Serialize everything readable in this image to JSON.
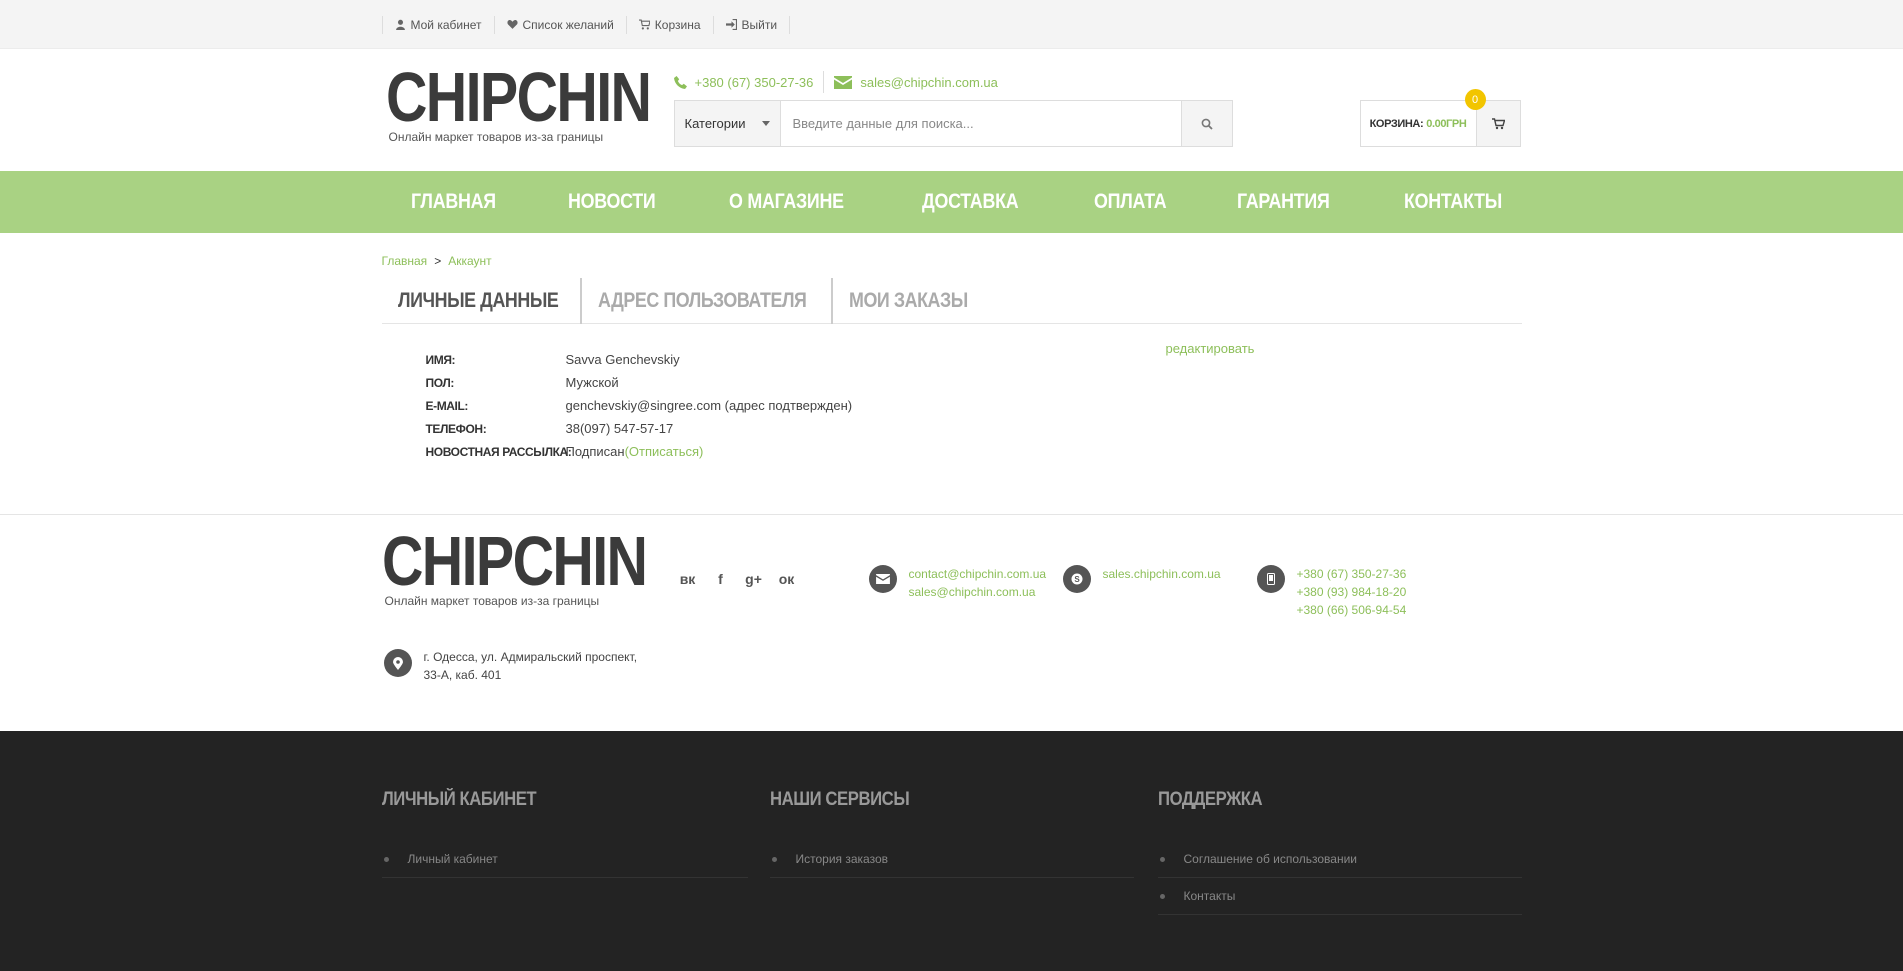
{
  "topbar": {
    "links": [
      {
        "label": "Мой кабинет",
        "icon": "user-icon"
      },
      {
        "label": "Список желаний",
        "icon": "heart-icon"
      },
      {
        "label": "Корзина",
        "icon": "cart-icon"
      },
      {
        "label": "Выйти",
        "icon": "sign-out-icon"
      }
    ]
  },
  "header": {
    "logo": "CHIPCHIN",
    "logo_sub": "Онлайн маркет товаров из-за границы",
    "phone": "+380 (67) 350-27-36",
    "email": "sales@chipchin.com.ua",
    "search": {
      "category": "Категории",
      "placeholder": "Введите данные для поиска..."
    },
    "cart": {
      "label": "КОРЗИНА:",
      "amount": "0.00ГРН",
      "count": "0"
    }
  },
  "nav": [
    "ГЛАВНАЯ",
    "НОВОСТИ",
    "О МАГАЗИНЕ",
    "ДОСТАВКА",
    "ОПЛАТА",
    "ГАРАНТИЯ",
    "КОНТАКТЫ"
  ],
  "breadcrumb": {
    "home": "Главная",
    "sep": ">",
    "current": "Аккаунт"
  },
  "tabs": [
    "ЛИЧНЫЕ ДАННЫЕ",
    "АДРЕС ПОЛЬЗОВАТЕЛЯ",
    "МОИ ЗАКАЗЫ"
  ],
  "profile": {
    "name_label": "ИМЯ:",
    "name": "Savva Genchevskiy",
    "gender_label": "ПОЛ:",
    "gender": "Мужской",
    "email_label": "E-MAIL:",
    "email": "genchevskiy@singree.com (адрес подтвержден)",
    "phone_label": "ТЕЛЕФОН:",
    "phone": "38(097) 547-57-17",
    "newsletter_label": "НОВОСТНАЯ РАССЫЛКА:",
    "newsletter": "Подписан",
    "unsubscribe": "(Отписаться)",
    "edit": "редактировать"
  },
  "footer": {
    "logo": "CHIPCHIN",
    "logo_sub": "Онлайн маркет товаров из-за границы",
    "social": [
      {
        "label": "вк",
        "icon": "vk-icon"
      },
      {
        "label": "f",
        "icon": "facebook-icon"
      },
      {
        "label": "g+",
        "icon": "google-plus-icon"
      },
      {
        "label": "ок",
        "icon": "odnoklassniki-icon"
      }
    ],
    "emails": [
      "contact@chipchin.com.ua",
      "sales@chipchin.com.ua"
    ],
    "skype": "sales.chipchin.com.ua",
    "phones": [
      "+380 (67) 350-27-36",
      "+380 (93) 984-18-20",
      "+380 (66) 506-94-54"
    ],
    "address_1": "г. Одесса, ул. Адмиральский проспект,",
    "address_2": "33-А, каб. 401"
  },
  "footer_cols": [
    {
      "title": "ЛИЧНЫЙ КАБИНЕТ",
      "items": [
        "Личный кабинет"
      ]
    },
    {
      "title": "НАШИ СЕРВИСЫ",
      "items": [
        "История заказов"
      ]
    },
    {
      "title": "ПОДДЕРЖКА",
      "items": [
        "Соглашение об использовании",
        "Контакты"
      ]
    }
  ]
}
